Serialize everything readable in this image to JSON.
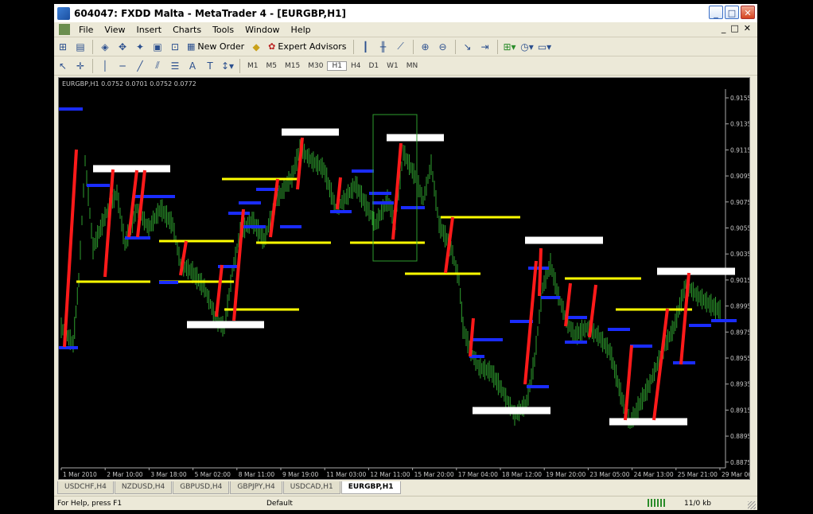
{
  "window": {
    "title": "604047: FXDD Malta - MetaTrader 4 - [EURGBP,H1]",
    "controls": {
      "minimize": "_",
      "maximize": "□",
      "close": "✕"
    }
  },
  "menu": {
    "items": [
      "File",
      "View",
      "Insert",
      "Charts",
      "Tools",
      "Window",
      "Help"
    ],
    "mdi": [
      "_",
      "□",
      "✕"
    ]
  },
  "toolbar1": {
    "new_order_label": "New Order",
    "expert_advisors_label": "Expert Advisors"
  },
  "toolbar2": {
    "timeframes": [
      "M1",
      "M5",
      "M15",
      "M30",
      "H1",
      "H4",
      "D1",
      "W1",
      "MN"
    ],
    "active_timeframe": "H1"
  },
  "chart": {
    "header": "EURGBP,H1  0.0752 0.0701 0.0752 0.0772",
    "price_labels": [
      "0.9155",
      "0.9135",
      "0.9115",
      "0.9095",
      "0.9075",
      "0.9055",
      "0.9035",
      "0.9015",
      "0.8995",
      "0.8975",
      "0.8955",
      "0.8935",
      "0.8915",
      "0.8895",
      "0.8875"
    ],
    "date_labels": [
      "1 Mar 2010",
      "2 Mar 10:00",
      "3 Mar 18:00",
      "5 Mar 02:00",
      "8 Mar 11:00",
      "9 Mar 19:00",
      "11 Mar 03:00",
      "12 Mar 11:00",
      "15 Mar 20:00",
      "17 Mar 04:00",
      "18 Mar 12:00",
      "19 Mar 20:00",
      "23 Mar 05:00",
      "24 Mar 13:00",
      "25 Mar 21:00",
      "29 Mar 06:00"
    ],
    "colors": {
      "bg": "#000000",
      "bars": "#2e9e2e",
      "red": "#ff1a1a",
      "blue": "#1a2cff",
      "yellow": "#ffff00",
      "white": "#ffffff",
      "box": "#2e9e2e",
      "text": "#c8c8c8"
    }
  },
  "tabs": {
    "items": [
      "USDCHF,H4",
      "NZDUSD,H4",
      "GBPUSD,H4",
      "GBPJPY,H4",
      "USDCAD,H1",
      "EURGBP,H1"
    ],
    "active": "EURGBP,H1"
  },
  "status": {
    "help": "For Help, press F1",
    "profile": "Default",
    "traffic": "11/0 kb"
  }
}
